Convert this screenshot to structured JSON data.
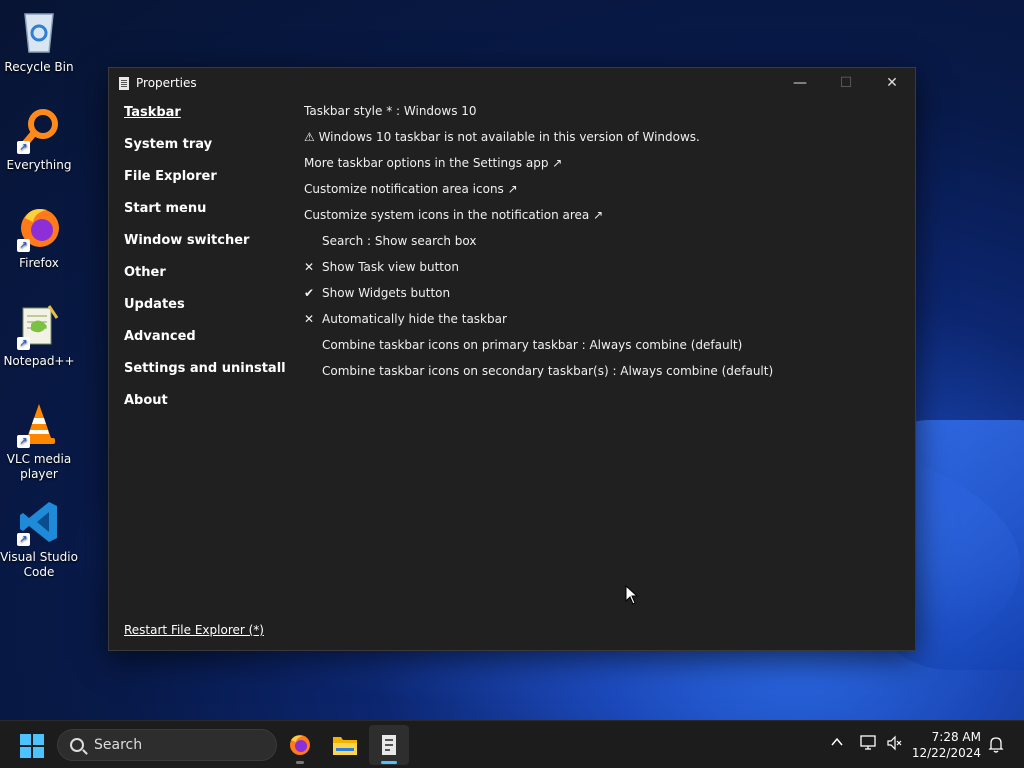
{
  "desktop": {
    "icons": [
      {
        "label": "Recycle Bin",
        "icon": "recycle-bin-icon"
      },
      {
        "label": "Everything",
        "icon": "everything-search-icon"
      },
      {
        "label": "Firefox",
        "icon": "firefox-icon"
      },
      {
        "label": "Notepad++",
        "icon": "notepad-plus-plus-icon"
      },
      {
        "label": "VLC media player",
        "icon": "vlc-icon"
      },
      {
        "label": "Visual Studio Code",
        "icon": "vscode-icon"
      }
    ]
  },
  "window": {
    "title": "Properties",
    "controls": {
      "minimize": "—",
      "maximize": "☐",
      "close": "✕"
    },
    "sidebar": [
      {
        "label": "Taskbar",
        "active": true
      },
      {
        "label": "System tray"
      },
      {
        "label": "File Explorer"
      },
      {
        "label": "Start menu"
      },
      {
        "label": "Window switcher"
      },
      {
        "label": "Other"
      },
      {
        "label": "Updates"
      },
      {
        "label": "Advanced"
      },
      {
        "label": "Settings and uninstall"
      },
      {
        "label": "About"
      }
    ],
    "content": {
      "taskbar_style": "Taskbar style * : Windows 10",
      "warning": "⚠ Windows 10 taskbar is not available in this version of Windows.",
      "settings_link": "More taskbar options in the Settings app ↗",
      "notif_link": "Customize notification area icons ↗",
      "sysicons_link": "Customize system icons in the notification area ↗",
      "search": "Search : Show search box",
      "task_view": {
        "label": "Show Task view button",
        "mark": "✕"
      },
      "widgets": {
        "label": "Show Widgets button",
        "mark": "✔"
      },
      "autohide": {
        "label": "Automatically hide the taskbar",
        "mark": "✕"
      },
      "combine_primary": "Combine taskbar icons on primary taskbar : Always combine (default)",
      "combine_secondary": "Combine taskbar icons on secondary taskbar(s) : Always combine (default)"
    },
    "restart_link": "Restart File Explorer (*)"
  },
  "taskbar": {
    "search_placeholder": "Search",
    "apps": [
      "firefox-icon",
      "file-explorer-icon",
      "properties-app-icon"
    ],
    "time": "7:28 AM",
    "date": "12/22/2024",
    "tray_icons": [
      "chevron-up-icon",
      "network-icon",
      "volume-muted-icon",
      "notification-bell-icon"
    ]
  },
  "colors": {
    "accent": "#4cc2ff",
    "window_bg": "#202020",
    "taskbar_bg": "#1c1c1c"
  }
}
